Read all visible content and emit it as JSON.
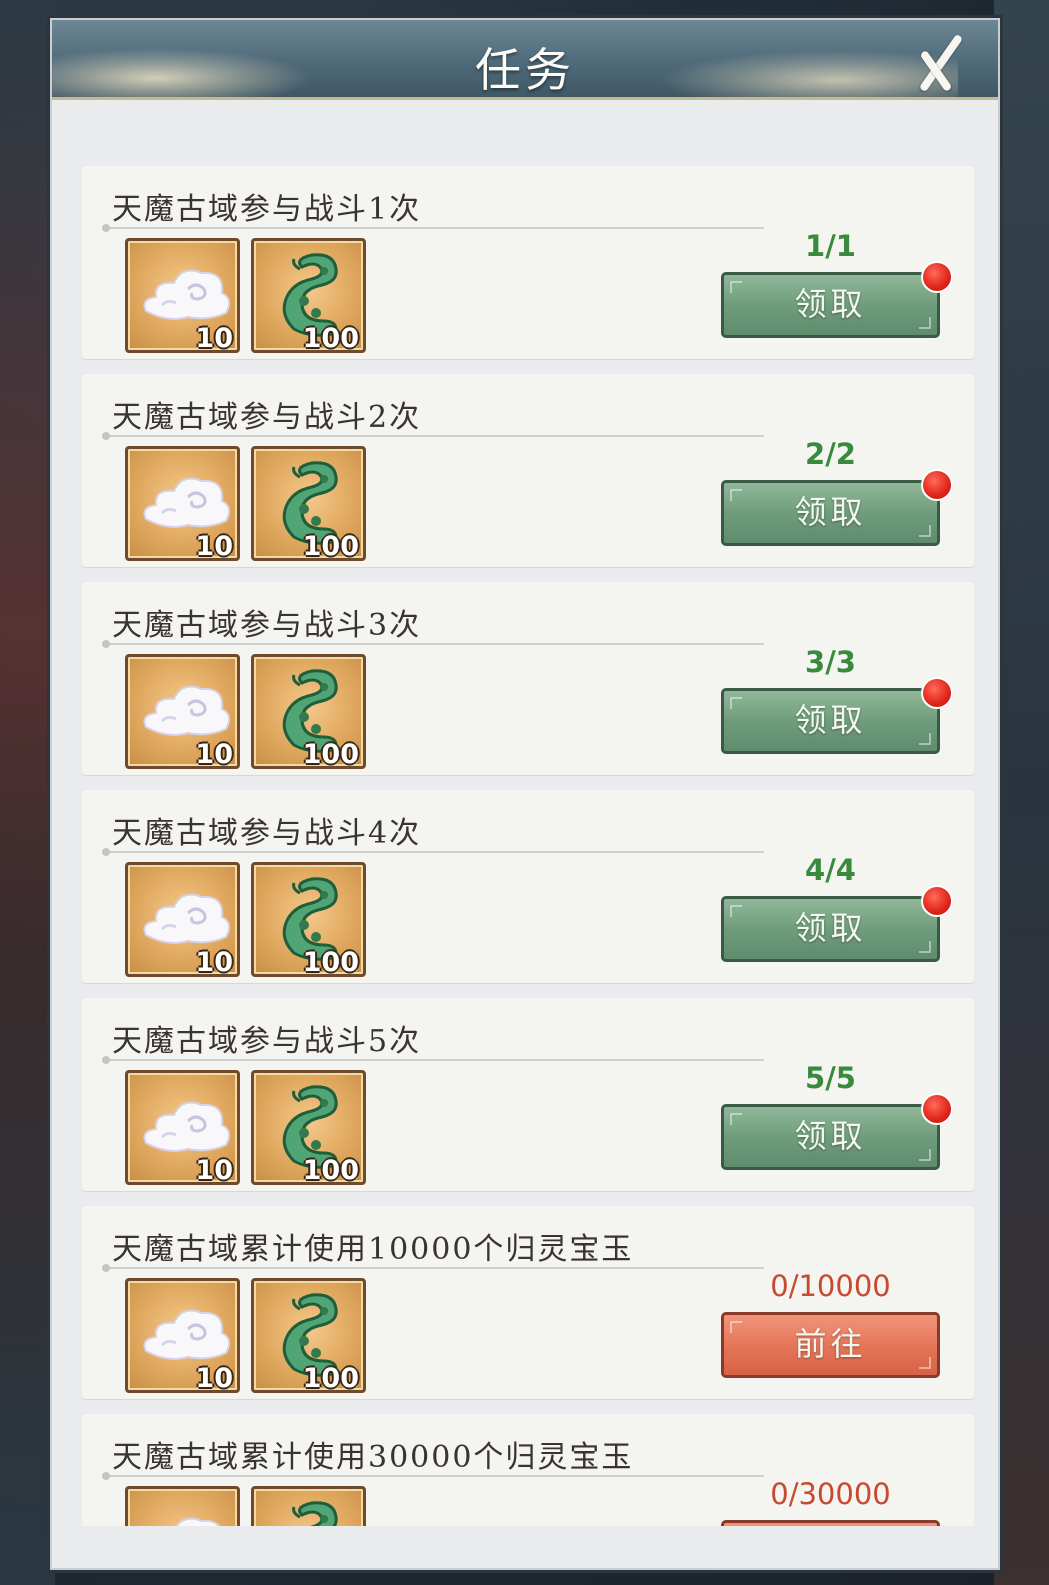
{
  "window": {
    "title": "任务",
    "close_icon": "close-icon"
  },
  "tasks": [
    {
      "title": "天魔古域参与战斗1次",
      "progress": "1/1",
      "button": "领取",
      "status": "claimable",
      "has_red_dot": true,
      "rewards": [
        {
          "icon": "cloud-icon",
          "qty": "10"
        },
        {
          "icon": "jade-dragon-icon",
          "qty": "100"
        }
      ]
    },
    {
      "title": "天魔古域参与战斗2次",
      "progress": "2/2",
      "button": "领取",
      "status": "claimable",
      "has_red_dot": true,
      "rewards": [
        {
          "icon": "cloud-icon",
          "qty": "10"
        },
        {
          "icon": "jade-dragon-icon",
          "qty": "100"
        }
      ]
    },
    {
      "title": "天魔古域参与战斗3次",
      "progress": "3/3",
      "button": "领取",
      "status": "claimable",
      "has_red_dot": true,
      "rewards": [
        {
          "icon": "cloud-icon",
          "qty": "10"
        },
        {
          "icon": "jade-dragon-icon",
          "qty": "100"
        }
      ]
    },
    {
      "title": "天魔古域参与战斗4次",
      "progress": "4/4",
      "button": "领取",
      "status": "claimable",
      "has_red_dot": true,
      "rewards": [
        {
          "icon": "cloud-icon",
          "qty": "10"
        },
        {
          "icon": "jade-dragon-icon",
          "qty": "100"
        }
      ]
    },
    {
      "title": "天魔古域参与战斗5次",
      "progress": "5/5",
      "button": "领取",
      "status": "claimable",
      "has_red_dot": true,
      "rewards": [
        {
          "icon": "cloud-icon",
          "qty": "10"
        },
        {
          "icon": "jade-dragon-icon",
          "qty": "100"
        }
      ]
    },
    {
      "title": "天魔古域累计使用10000个归灵宝玉",
      "progress": "0/10000",
      "button": "前往",
      "status": "go",
      "has_red_dot": false,
      "rewards": [
        {
          "icon": "cloud-icon",
          "qty": "10"
        },
        {
          "icon": "jade-dragon-icon",
          "qty": "100"
        }
      ]
    },
    {
      "title": "天魔古域累计使用30000个归灵宝玉",
      "progress": "0/30000",
      "button": "",
      "status": "go",
      "has_red_dot": false,
      "rewards": [
        {
          "icon": "cloud-icon",
          "qty": ""
        },
        {
          "icon": "jade-dragon-icon",
          "qty": ""
        }
      ]
    }
  ],
  "colors": {
    "claim_button": "#6f9d7c",
    "go_button": "#e57457",
    "progress_done": "#3a8a3e",
    "progress_pending": "#c9492f",
    "red_dot": "#e0241a"
  }
}
